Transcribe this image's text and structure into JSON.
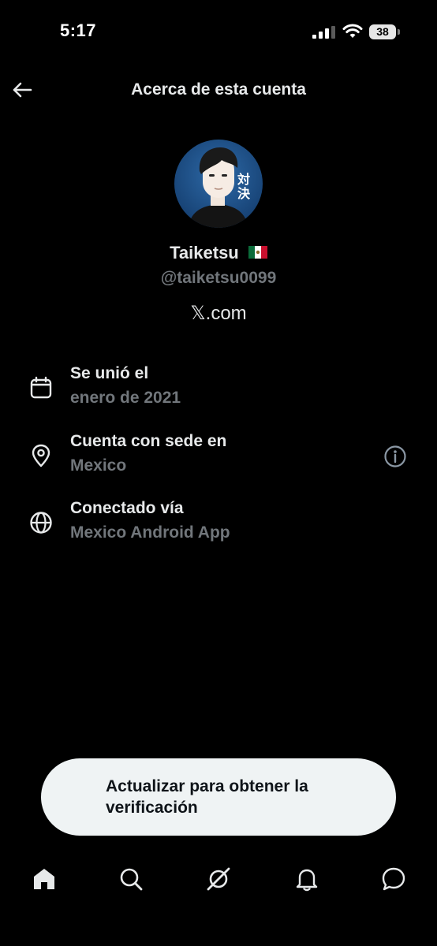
{
  "status_bar": {
    "time": "5:17",
    "battery_level": "38",
    "signal_icon": "cellular-signal-icon",
    "wifi_icon": "wifi-icon"
  },
  "header": {
    "title": "Acerca de esta cuenta",
    "back_icon": "arrow-left-icon"
  },
  "profile": {
    "name": "Taiketsu",
    "flag_icon": "mexico-flag-icon",
    "handle": "@taiketsu0099",
    "platform_glyph": "𝕏",
    "platform_suffix": ".com",
    "avatar_text": "対決"
  },
  "details": [
    {
      "icon": "calendar-icon",
      "label": "Se unió el",
      "value": "enero de 2021"
    },
    {
      "icon": "location-pin-icon",
      "label": "Cuenta con sede en",
      "value": "Mexico",
      "extra_icon": "info-circle-icon"
    },
    {
      "icon": "globe-icon",
      "label": "Conectado vía",
      "value": "Mexico Android App"
    }
  ],
  "cta": {
    "label": "Actualizar para obtener la verificación"
  },
  "tabbar": {
    "items": [
      {
        "icon": "home-icon"
      },
      {
        "icon": "search-icon"
      },
      {
        "icon": "grok-icon"
      },
      {
        "icon": "bell-icon"
      },
      {
        "icon": "messages-icon"
      }
    ]
  },
  "colors": {
    "background": "#000000",
    "primary_text": "#e7e9ea",
    "secondary_text": "#71767b",
    "cta_background": "#eff3f4",
    "cta_text": "#0f1419",
    "avatar_background": "#1f4f86"
  }
}
